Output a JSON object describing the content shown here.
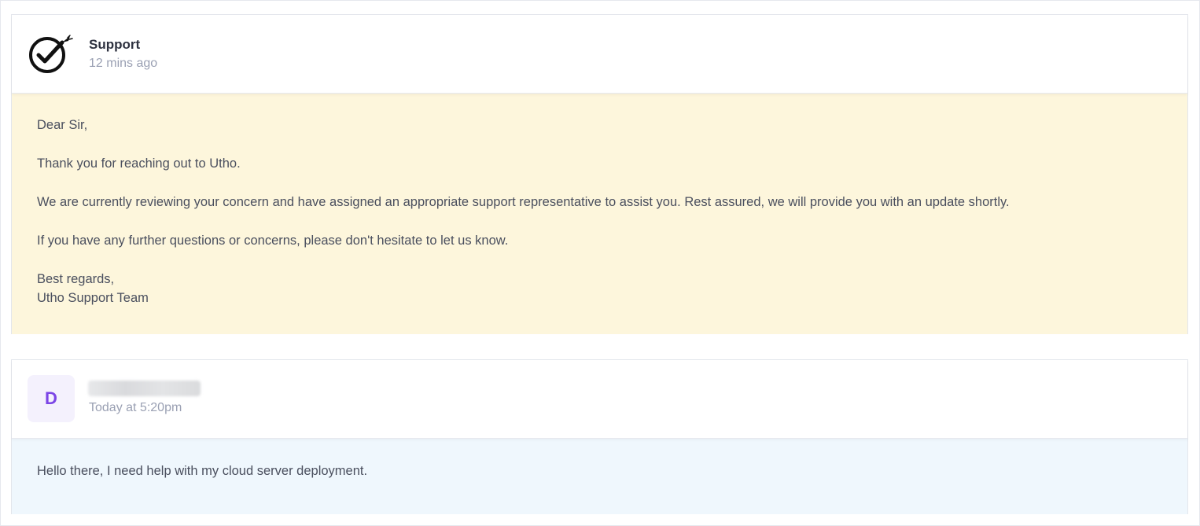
{
  "messages": [
    {
      "author": "Support",
      "logo_icon": "checkmark-rocket-logo-icon",
      "time": "12 mins ago",
      "background": "#fdf6dc",
      "body": {
        "greeting": "Dear Sir,",
        "p1": "Thank you for reaching out to Utho.",
        "p2": "We are currently reviewing your concern and have assigned an appropriate support representative to assist you. Rest assured, we will provide you with an update shortly.",
        "p3": "If you have any further questions or concerns, please don't hesitate to let us know.",
        "signoff": "Best regards,",
        "signature": "Utho Support Team"
      }
    },
    {
      "author_initial": "D",
      "author_redacted": true,
      "time": "Today at 5:20pm",
      "background": "#eff7fd",
      "accent": "#7b45e6",
      "body": {
        "text": "Hello there, I need help with my cloud server deployment."
      }
    }
  ]
}
